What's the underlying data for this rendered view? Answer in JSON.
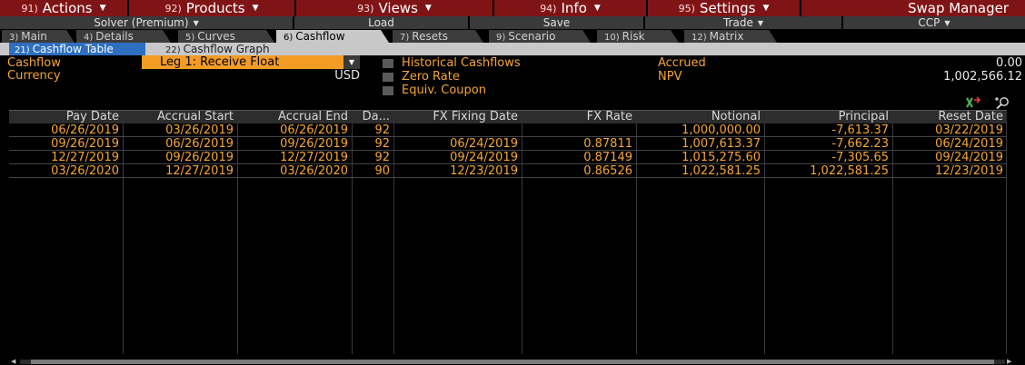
{
  "menubar": {
    "items": [
      {
        "num": "91)",
        "label": "Actions"
      },
      {
        "num": "92)",
        "label": "Products"
      },
      {
        "num": "93)",
        "label": "Views"
      },
      {
        "num": "94)",
        "label": "Info"
      },
      {
        "num": "95)",
        "label": "Settings"
      }
    ],
    "app_title": "Swap Manager"
  },
  "toolbar": {
    "solver": "Solver (Premium)",
    "load": "Load",
    "save": "Save",
    "trade": "Trade",
    "ccp": "CCP"
  },
  "tabs": [
    {
      "num": "3)",
      "label": "Main"
    },
    {
      "num": "4)",
      "label": "Details"
    },
    {
      "num": "5)",
      "label": "Curves"
    },
    {
      "num": "6)",
      "label": "Cashflow"
    },
    {
      "num": "7)",
      "label": "Resets"
    },
    {
      "num": "9)",
      "label": "Scenario"
    },
    {
      "num": "10)",
      "label": "Risk"
    },
    {
      "num": "12)",
      "label": "Matrix"
    }
  ],
  "active_tab": "Cashflow",
  "subtabs": [
    {
      "num": "21)",
      "label": "Cashflow Table"
    },
    {
      "num": "22)",
      "label": "Cashflow Graph"
    }
  ],
  "info": {
    "cashflow_label": "Cashflow",
    "cashflow_value": "Leg 1: Receive Float",
    "currency_label": "Currency",
    "currency_value": "USD",
    "historical_label": "Historical Cashflows",
    "zero_rate_label": "Zero Rate",
    "equiv_coupon_label": "Equiv. Coupon",
    "accrued_label": "Accrued",
    "accrued_value": "0.00",
    "npv_label": "NPV",
    "npv_value": "1,002,566.12"
  },
  "table": {
    "columns": [
      "Pay Date",
      "Accrual Start",
      "Accrual End",
      "Da...",
      "FX Fixing Date",
      "FX Rate",
      "Notional",
      "Principal",
      "Reset Date"
    ],
    "rows": [
      [
        "06/26/2019",
        "03/26/2019",
        "06/26/2019",
        "92",
        "",
        "",
        "1,000,000.00",
        "-7,613.37",
        "03/22/2019"
      ],
      [
        "09/26/2019",
        "06/26/2019",
        "09/26/2019",
        "92",
        "06/24/2019",
        "0.87811",
        "1,007,613.37",
        "-7,662.23",
        "06/24/2019"
      ],
      [
        "12/27/2019",
        "09/26/2019",
        "12/27/2019",
        "92",
        "09/24/2019",
        "0.87149",
        "1,015,275.60",
        "-7,305.65",
        "09/24/2019"
      ],
      [
        "03/26/2020",
        "12/27/2019",
        "03/26/2020",
        "90",
        "12/23/2019",
        "0.86526",
        "1,022,581.25",
        "1,022,581.25",
        "12/23/2019"
      ]
    ]
  },
  "colors": {
    "menu_bg": "#7f1416",
    "accent_orange": "#f5a533",
    "active_subtab": "#2f6fbf"
  },
  "icons": [
    "export-excel-icon",
    "zoom-search-icon"
  ]
}
